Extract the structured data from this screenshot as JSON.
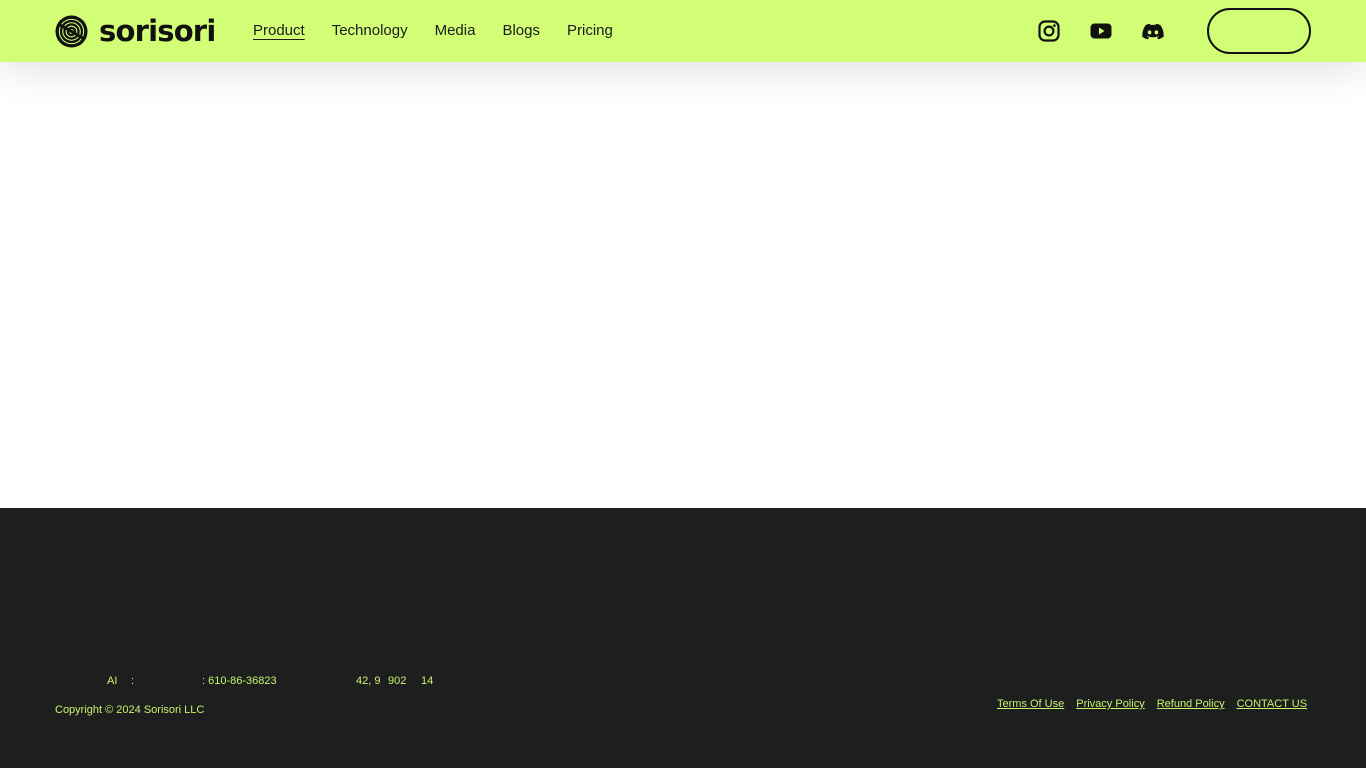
{
  "header": {
    "logo_text": "sorisori",
    "nav": [
      {
        "label": "Product",
        "active": true
      },
      {
        "label": "Technology",
        "active": false
      },
      {
        "label": "Media",
        "active": false
      },
      {
        "label": "Blogs",
        "active": false
      },
      {
        "label": "Pricing",
        "active": false
      }
    ],
    "social_icons": [
      "instagram-icon",
      "youtube-icon",
      "discord-icon"
    ],
    "background_color": "#d2fe76"
  },
  "footer": {
    "background_color": "#1e1e1e",
    "text_color": "#c6f36c",
    "company_info_fragments": [
      "AI",
      ":",
      ": 610-86-36823",
      "42, 9",
      "902",
      "14"
    ],
    "copyright": "Copyright © 2024 Sorisori LLC",
    "links": [
      "Terms Of Use",
      "Privacy Policy",
      "Refund Policy",
      "CONTACT US"
    ]
  }
}
